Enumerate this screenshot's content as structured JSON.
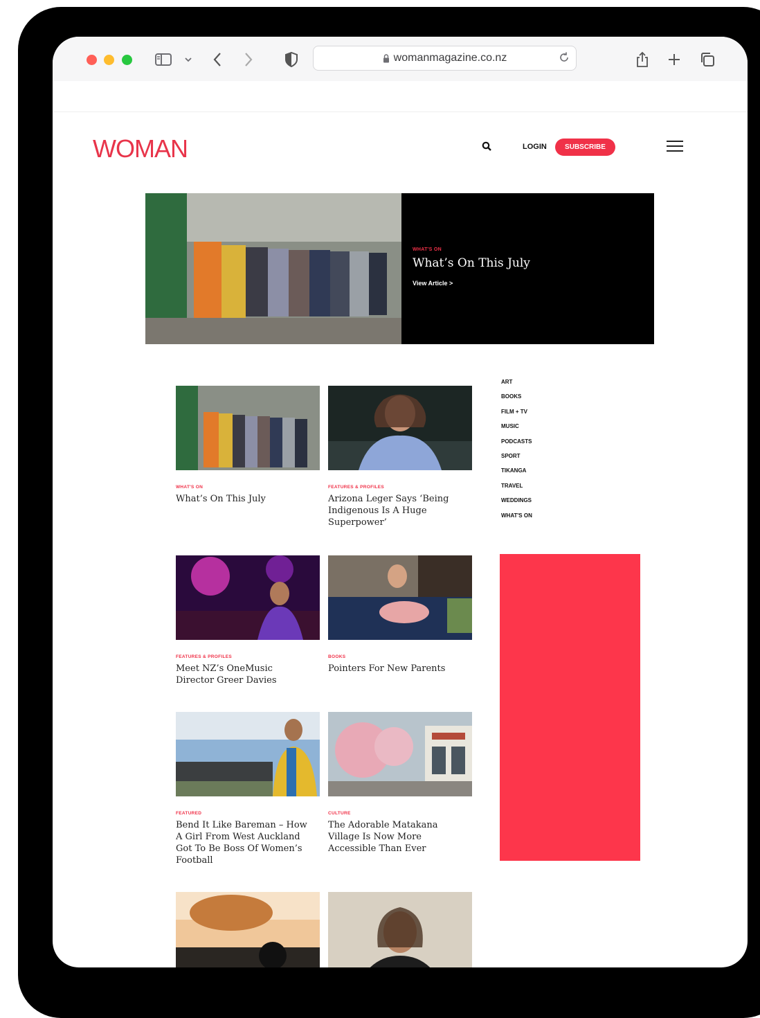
{
  "browser": {
    "url": "womanmagazine.co.nz"
  },
  "site": {
    "logo": "WOMAN",
    "login_label": "LOGIN",
    "subscribe_label": "SUBSCRIBE",
    "accent_color": "#f03148"
  },
  "hero": {
    "category": "WHAT'S ON",
    "title": "What’s On This July",
    "link": "View Article >"
  },
  "articles": [
    {
      "category": "WHAT'S ON",
      "title": "What’s On This July",
      "image": "women-in-vintage-dresses"
    },
    {
      "category": "FEATURES & PROFILES",
      "title": "Arizona Leger Says ‘Being Indigenous Is A Huge Superpower’",
      "image": "woman-in-theatre"
    },
    {
      "category": "FEATURES & PROFILES",
      "title": "Meet NZ’s OneMusic Director Greer Davies",
      "image": "woman-at-concert"
    },
    {
      "category": "BOOKS",
      "title": "Pointers For New Parents",
      "image": "mother-with-baby"
    },
    {
      "category": "FEATURED",
      "title": "Bend It Like Bareman – How A Girl From West Auckland Got To Be Boss Of Women’s Football",
      "image": "woman-at-stadium"
    },
    {
      "category": "CULTURE",
      "title": "The Adorable Matakana Village Is Now More Accessible Than Ever",
      "image": "village-street"
    },
    {
      "category": "",
      "title": "",
      "image": "weights"
    },
    {
      "category": "",
      "title": "",
      "image": "woman-portrait"
    }
  ],
  "sidebar": {
    "categories": [
      "ART",
      "BOOKS",
      "FILM + TV",
      "MUSIC",
      "PODCASTS",
      "SPORT",
      "TIKANGA",
      "TRAVEL",
      "WEDDINGS",
      "WHAT'S ON"
    ]
  }
}
